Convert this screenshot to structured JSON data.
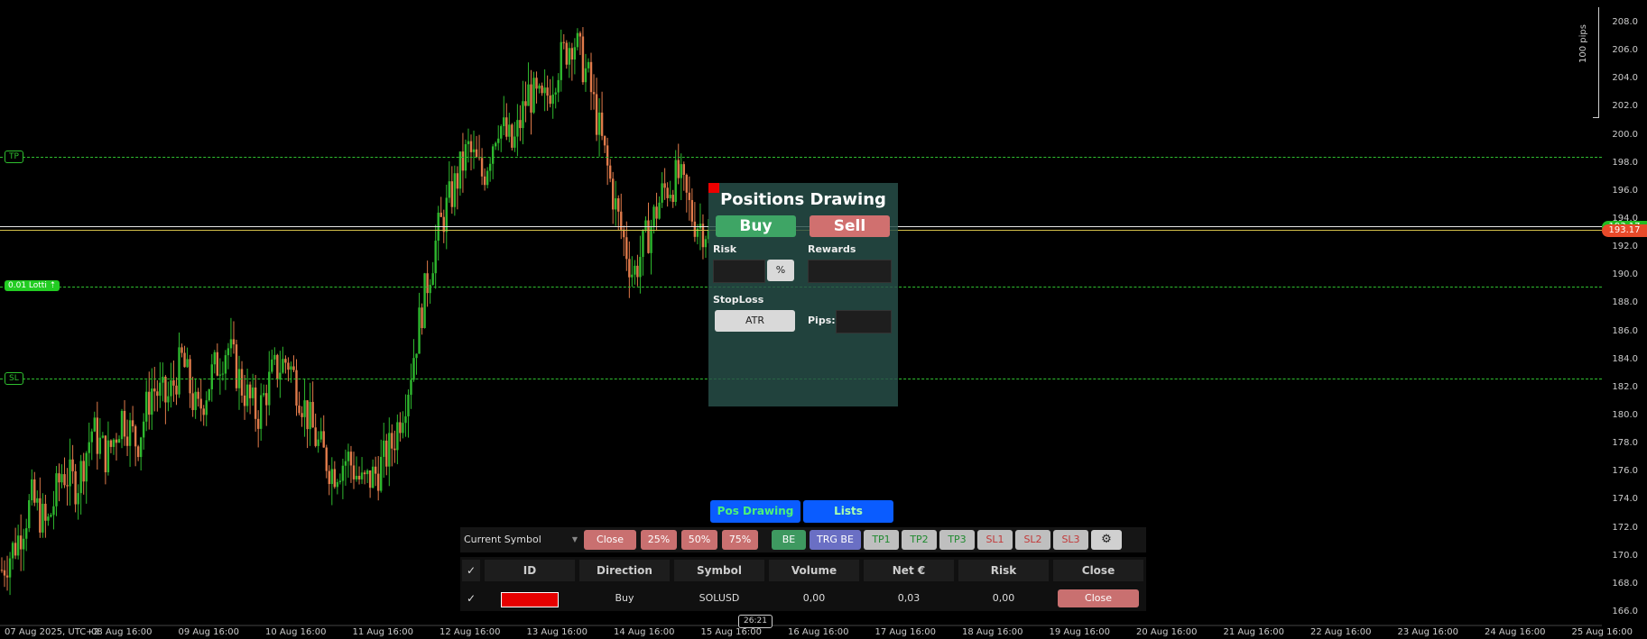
{
  "chart": {
    "lines": {
      "tp_label": "TP",
      "lot_label": "0.01 Lotti ⇡",
      "sl_label": "SL",
      "bid_price": "193.17",
      "ask_price": "193.17"
    },
    "pips_label": "100 pips",
    "time_tag": "26:21",
    "colors": {
      "bull": "#2eb82e",
      "bear": "#e07a4a",
      "level": "#2fbf2f",
      "price_line": "#e6e6e6"
    }
  },
  "chart_data": {
    "type": "candlestick",
    "title": "",
    "xlabel": "",
    "ylabel": "",
    "ylim": [
      165,
      209
    ],
    "y_ticks": [
      "166.0",
      "168.0",
      "170.0",
      "172.0",
      "174.0",
      "176.0",
      "178.0",
      "180.0",
      "182.0",
      "184.0",
      "186.0",
      "188.0",
      "190.0",
      "192.0",
      "194.0",
      "196.0",
      "198.0",
      "200.0",
      "202.0",
      "204.0",
      "206.0",
      "208.0"
    ],
    "x_ticks": [
      "07 Aug 2025, UTC+2",
      "08 Aug 16:00",
      "09 Aug 16:00",
      "10 Aug 16:00",
      "11 Aug 16:00",
      "12 Aug 16:00",
      "13 Aug 16:00",
      "14 Aug 16:00",
      "15 Aug 16:00",
      "16 Aug 16:00",
      "17 Aug 16:00",
      "18 Aug 16:00",
      "19 Aug 16:00",
      "20 Aug 16:00",
      "21 Aug 16:00",
      "22 Aug 16:00",
      "23 Aug 16:00",
      "24 Aug 16:00",
      "25 Aug 16:00"
    ],
    "levels": {
      "tp": 198.5,
      "lot": 189.2,
      "sl": 182.6,
      "current": 193.17
    },
    "path_closes": [
      169,
      171,
      174,
      172,
      176,
      175,
      179,
      177,
      180,
      178,
      182,
      181,
      184,
      180,
      183,
      185,
      182,
      180,
      183,
      184,
      181,
      178,
      176,
      177,
      175,
      176,
      178,
      182,
      188,
      193,
      196,
      199,
      197,
      201,
      199,
      203,
      202,
      205,
      207,
      204,
      199,
      194,
      190,
      193,
      196,
      197,
      194,
      193.17
    ]
  },
  "positions_drawing": {
    "title": "Positions Drawing",
    "buy_label": "Buy",
    "sell_label": "Sell",
    "risk_label": "Risk",
    "rewards_label": "Rewards",
    "percent_label": "%",
    "stoploss_label": "StopLoss",
    "atr_label": "ATR",
    "pips_label": "Pips:",
    "risk_value": "",
    "rewards_value": "",
    "pips_value": ""
  },
  "bottom_tabs": {
    "pos_drawing": "Pos Drawing",
    "lists": "Lists"
  },
  "toolbar": {
    "symbol_select": "Current Symbol",
    "close": "Close",
    "p25": "25%",
    "p50": "50%",
    "p75": "75%",
    "be": "BE",
    "trg_be": "TRG BE",
    "tp1": "TP1",
    "tp2": "TP2",
    "tp3": "TP3",
    "sl1": "SL1",
    "sl2": "SL2",
    "sl3": "SL3"
  },
  "table": {
    "columns": [
      "ID",
      "Direction",
      "Symbol",
      "Volume",
      "Net €",
      "Risk",
      "Close"
    ],
    "rows": [
      {
        "id_color": "#e60000",
        "direction": "Buy",
        "symbol": "SOLUSD",
        "volume": "0,00",
        "net": "0,03",
        "risk": "0,00",
        "close": "Close"
      }
    ]
  }
}
